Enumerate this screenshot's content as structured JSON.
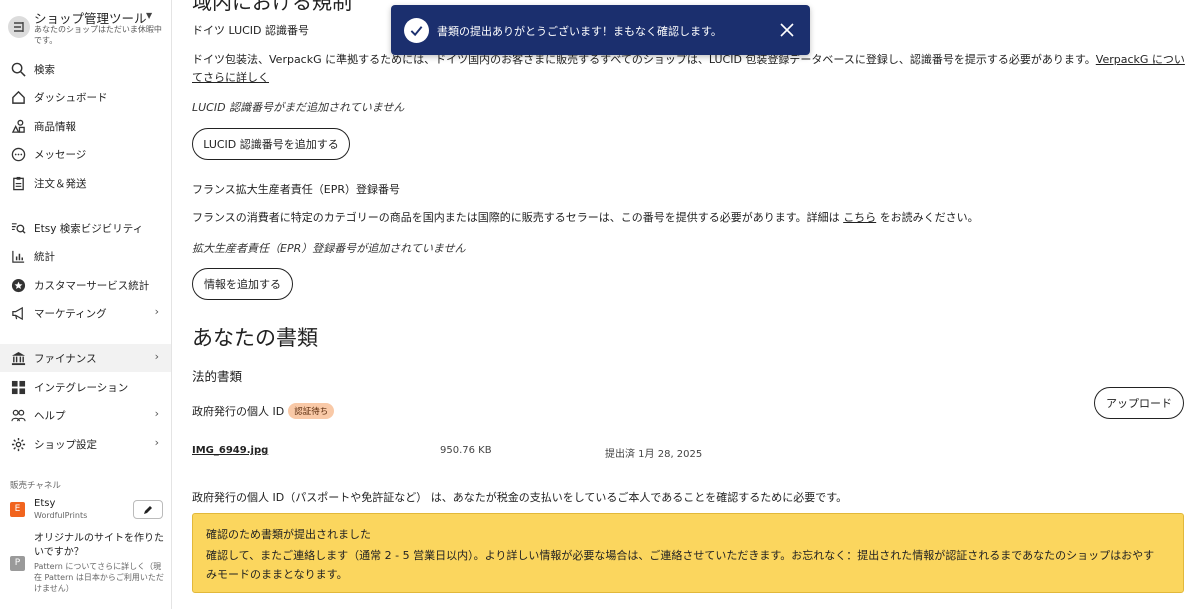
{
  "colors": {
    "toast_bg": "#1b2f6e",
    "notice_bg": "#fbd65e",
    "badge_bg": "#f9c9a7",
    "etsy_orange": "#f1641e",
    "pattern_gray": "#9a9a9a"
  },
  "sidebar": {
    "shop_title": "ショップ管理ツール",
    "shop_subtitle": "あなたのショップはただいま休暇中です。",
    "nav": [
      {
        "label": "検索",
        "icon": "search-icon"
      },
      {
        "label": "ダッシュボード",
        "icon": "home-icon"
      },
      {
        "label": "商品情報",
        "icon": "listings-icon"
      },
      {
        "label": "メッセージ",
        "icon": "message-icon"
      },
      {
        "label": "注文＆発送",
        "icon": "clipboard-icon"
      },
      {
        "label": "Etsy 検索ビジビリティ",
        "icon": "search-visibility-icon"
      },
      {
        "label": "統計",
        "icon": "stats-icon"
      },
      {
        "label": "カスタマーサービス統計",
        "icon": "star-badge-icon"
      },
      {
        "label": "マーケティング",
        "icon": "megaphone-icon"
      },
      {
        "label": "ファイナンス",
        "icon": "bank-icon"
      },
      {
        "label": "インテグレーション",
        "icon": "grid-icon"
      },
      {
        "label": "ヘルプ",
        "icon": "people-icon"
      },
      {
        "label": "ショップ設定",
        "icon": "gear-icon"
      }
    ],
    "channels_heading": "販売チャネル",
    "etsy": {
      "badge": "E",
      "name": "Etsy",
      "shop": "WordfulPrints"
    },
    "pattern": {
      "badge": "P",
      "title": "オリジナルのサイトを作りたいですか？",
      "subtitle": "Pattern についてさらに詳しく（現在 Pattern は日本からご利用いただけません）"
    }
  },
  "main": {
    "cut_heading": "域内における規制",
    "lucid": {
      "heading": "ドイツ LUCID 認識番号",
      "desc_before": "ドイツ包装法、VerpackG に準拠するためには、ドイツ国内のお客さまに販売するすべてのショップは、LUCID 包装登録データベースに登録し、認識番号を提示する必要があります。",
      "link_part1": "VerpackG につい",
      "link_part2": "てさらに詳しく",
      "status": "LUCID 認識番号がまだ追加されていません",
      "button": "LUCID 認識番号を追加する"
    },
    "epr": {
      "heading": "フランス拡大生産者責任（EPR）登録番号",
      "desc_before": "フランスの消費者に特定のカテゴリーの商品を国内または国際的に販売するセラーは、この番号を提供する必要があります。詳細は",
      "link": "こちら",
      "desc_after": "をお読みください。",
      "status": "拡大生産者責任（EPR）登録番号が追加されていません",
      "button": "情報を追加する"
    },
    "documents": {
      "heading": "あなたの書類",
      "subheading": "法的書類",
      "id_label": "政府発行の個人 ID",
      "status_badge": "認証待ち",
      "upload_button": "アップロード",
      "file": {
        "name": "IMG_6949.jpg",
        "size": "950.76 KB",
        "submitted": "提出済 1月 28, 2025"
      },
      "description": "政府発行の個人 ID（パスポートや免許証など） は、あなたが税金の支払いをしているご本人であることを確認するために必要です。",
      "notice_title": "確認のため書類が提出されました",
      "notice_body": "確認して、またご連絡します（通常 2 - 5 営業日以内）。より詳しい情報が必要な場合は、ご連絡させていただきます。お忘れなく：提出された情報が認証されるまであなたのショップはおやすみモードのままとなります。"
    }
  },
  "toast": {
    "message": "書類の提出ありがとうございます！まもなく確認します。",
    "icon": "check-icon",
    "close_icon": "close-icon"
  }
}
